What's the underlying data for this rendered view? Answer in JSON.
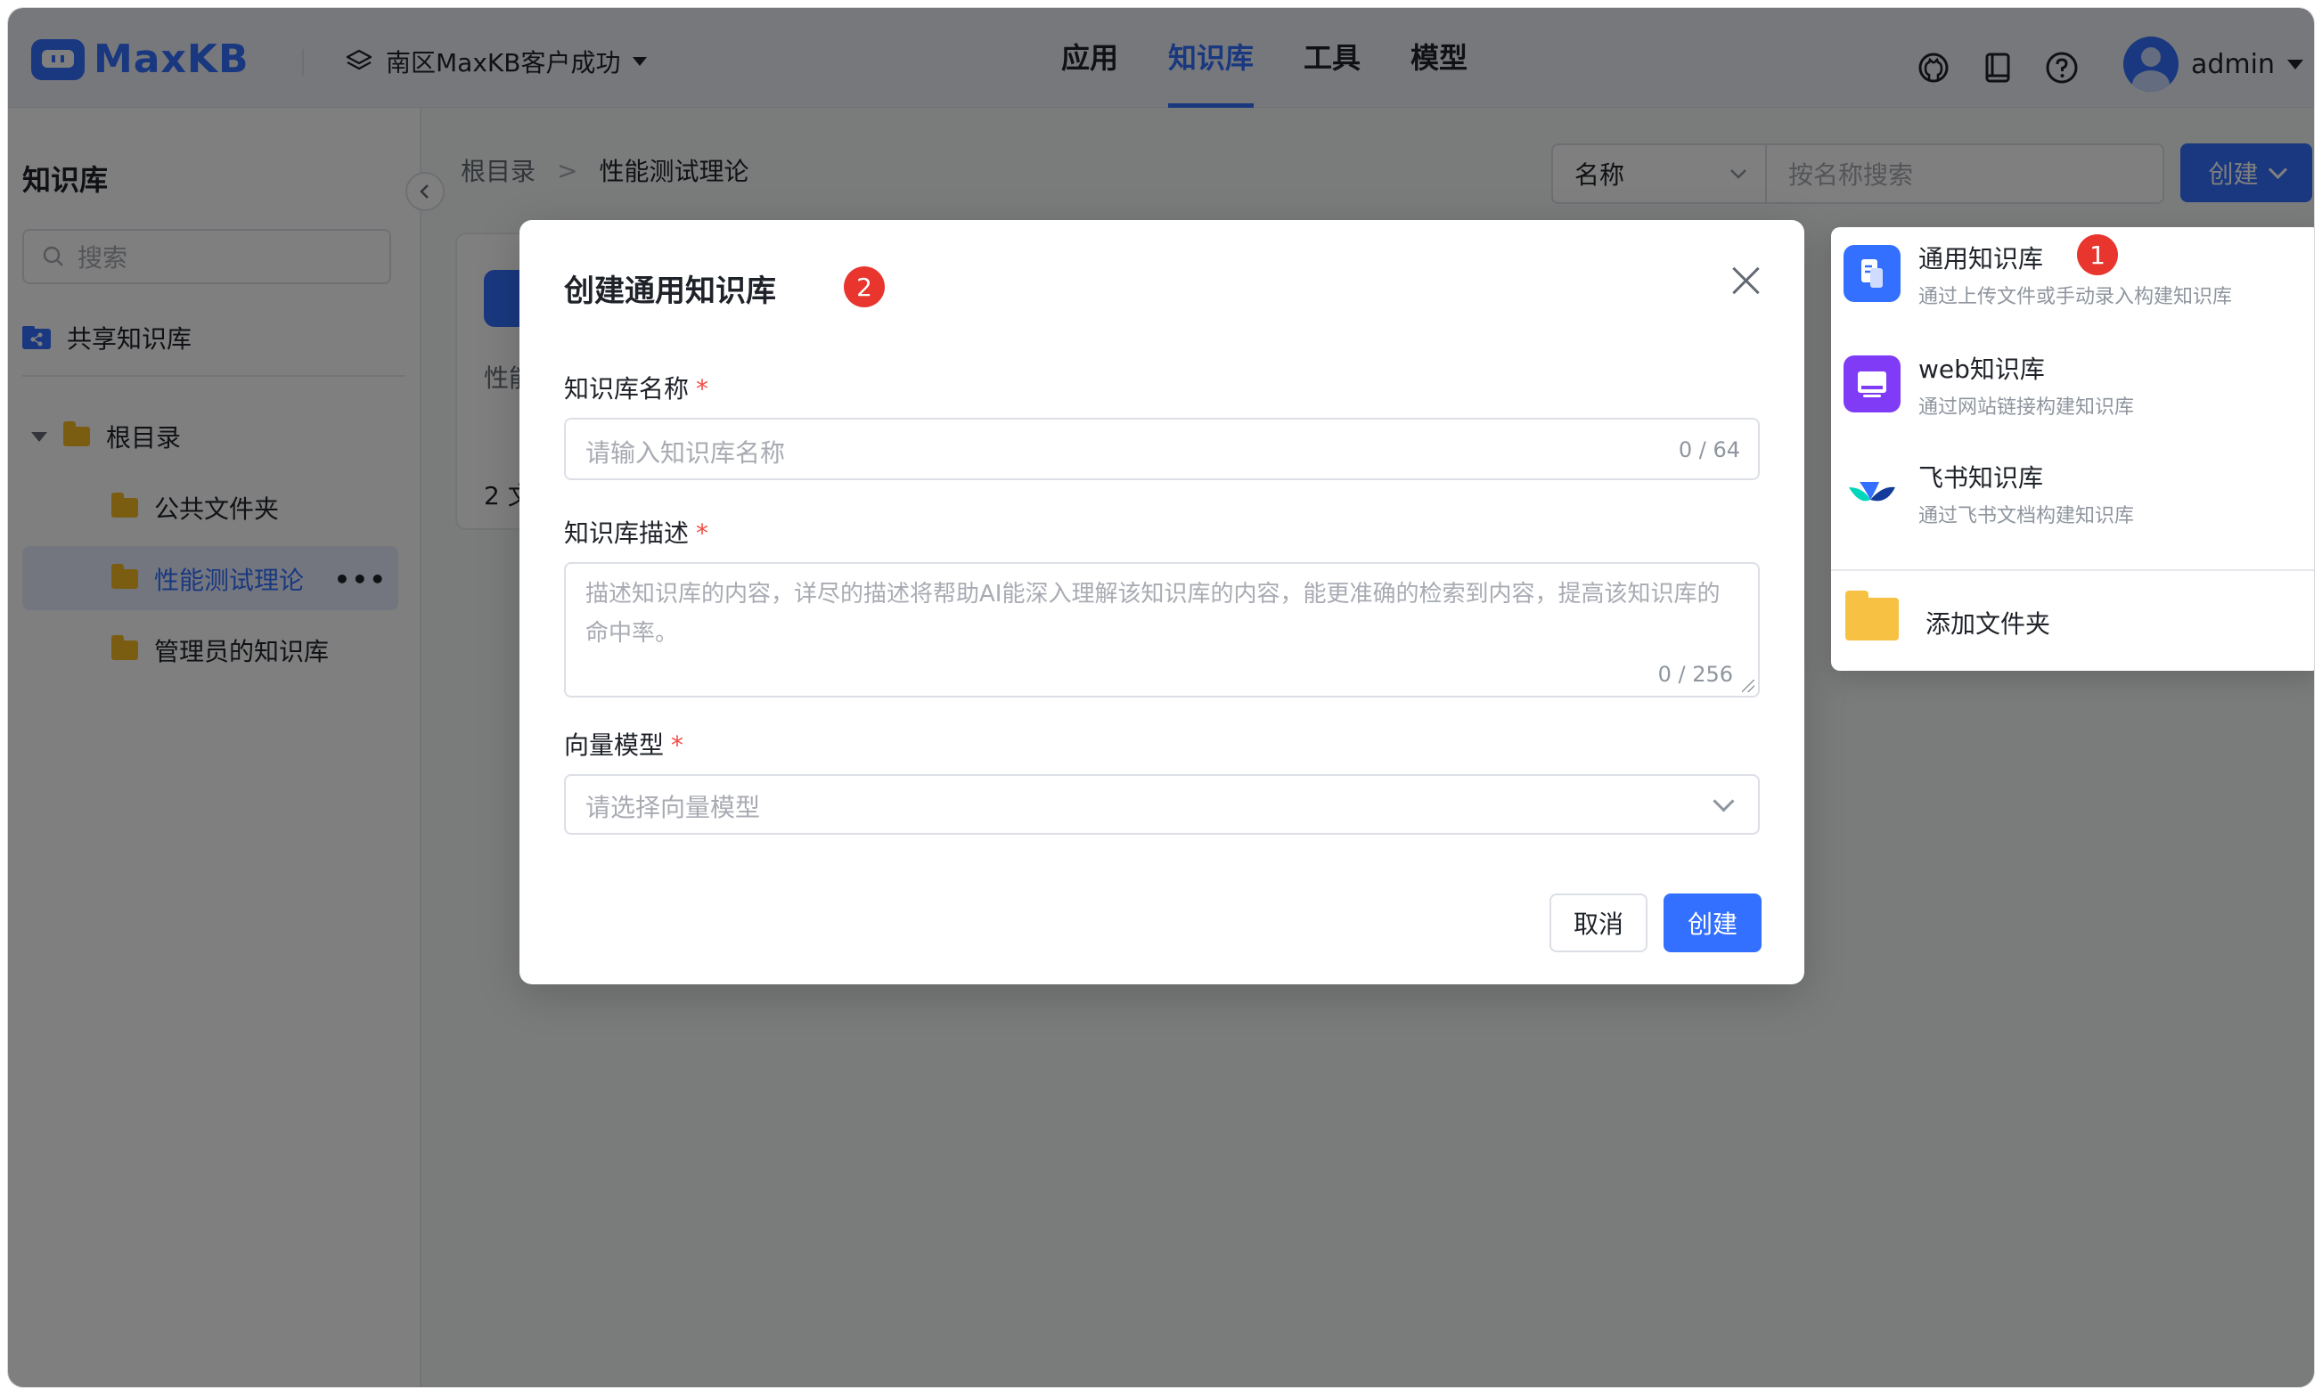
{
  "header": {
    "logo": "MaxKB",
    "workspace": "南区MaxKB客户成功",
    "nav": [
      {
        "label": "应用",
        "active": false
      },
      {
        "label": "知识库",
        "active": true
      },
      {
        "label": "工具",
        "active": false
      },
      {
        "label": "模型",
        "active": false
      }
    ],
    "icons": [
      "github-icon",
      "docs-icon",
      "help-icon"
    ],
    "user": "admin"
  },
  "sidebar": {
    "title": "知识库",
    "search_placeholder": "搜索",
    "shared": "共享知识库",
    "tree": [
      {
        "label": "根目录",
        "level": 0
      },
      {
        "label": "公共文件夹",
        "level": 1
      },
      {
        "label": "性能测试理论",
        "level": 1,
        "active": true
      },
      {
        "label": "管理员的知识库",
        "level": 1
      }
    ],
    "more": "•••"
  },
  "main": {
    "breadcrumb": [
      "根目录",
      "性能测试理论"
    ],
    "breadcrumb_sep": ">",
    "filter_select": "名称",
    "filter_placeholder": "按名称搜索",
    "create_label": "创建",
    "card_text": "性能",
    "card_count": "2 文"
  },
  "modal": {
    "title": "创建通用知识库",
    "badge": "2",
    "name_label": "知识库名称",
    "required_mark": "*",
    "name_placeholder": "请输入知识库名称",
    "name_counter": "0 / 64",
    "desc_label": "知识库描述",
    "desc_placeholder": "描述知识库的内容，详尽的描述将帮助AI能深入理解该知识库的内容，能更准确的检索到内容，提高该知识库的命中率。",
    "desc_counter": "0 / 256",
    "model_label": "向量模型",
    "model_placeholder": "请选择向量模型",
    "cancel": "取消",
    "confirm": "创建"
  },
  "dropdown": {
    "badge": "1",
    "items": [
      {
        "name": "通用知识库",
        "desc": "通过上传文件或手动录入构建知识库",
        "color": "#3370ff"
      },
      {
        "name": "web知识库",
        "desc": "通过网站链接构建知识库",
        "color": "#7f3bf5"
      },
      {
        "name": "飞书知识库",
        "desc": "通过飞书文档构建知识库",
        "color": "#133c9a"
      }
    ],
    "add_folder": "添加文件夹"
  },
  "colors": {
    "primary": "#3370ff",
    "badge": "#e8352e",
    "folder": "#f4bb23"
  }
}
